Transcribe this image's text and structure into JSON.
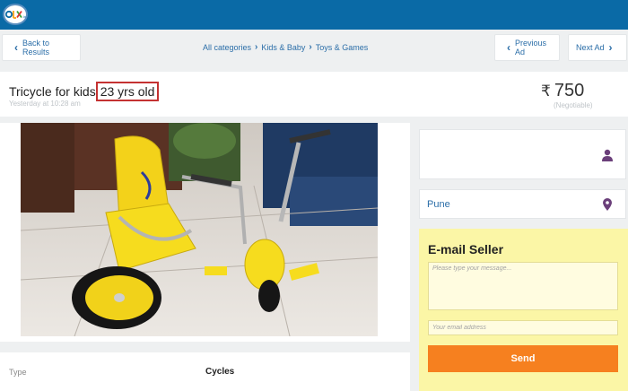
{
  "header": {
    "logo": "OLX.in"
  },
  "nav": {
    "back_label": "Back to Results",
    "prev_label": "Previous Ad",
    "next_label": "Next Ad",
    "breadcrumb": [
      "All categories",
      "Kids & Baby",
      "Toys & Games"
    ]
  },
  "ad": {
    "title": "Tricycle for kids",
    "age": "23 yrs old",
    "posted": "Yesterday at 10:28 am",
    "currency_symbol": "₹",
    "price": "750",
    "price_note": "(Negotiable)",
    "photo_desc": "Yellow tricycle photo"
  },
  "specs": {
    "type_label": "Type",
    "type_value": "Cycles"
  },
  "sidebar": {
    "location": "Pune",
    "email_title": "E-mail Seller",
    "message_placeholder": "Please type your message...",
    "email_placeholder": "Your email address",
    "send_label": "Send"
  },
  "colors": {
    "topbar": "#0a6aa6",
    "link": "#2b6ea8",
    "highlight_box": "#c43232",
    "email_panel": "#fbf6a6",
    "send_button": "#f6801f",
    "icon": "#6b3f7a"
  }
}
